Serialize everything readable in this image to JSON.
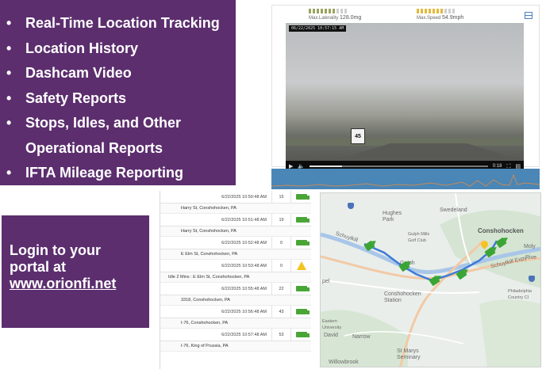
{
  "features": {
    "items": [
      "Real-Time Location Tracking",
      "Location History",
      "Dashcam Video",
      "Safety Reports",
      "Stops, Idles, and Other Operational Reports",
      "IFTA Mileage Reporting"
    ]
  },
  "login": {
    "line1": "Login to your",
    "line2": "portal at",
    "url": "www.orionfi.net"
  },
  "video": {
    "lateral_label": "Max.Laterality",
    "lateral_value": "128.0mg",
    "speed_label": "Max.Speed",
    "speed_value": "54.9mph",
    "timestamp": "06/22/2025 10:57:15 AM",
    "sign_text": "45",
    "time_readout": "0:18",
    "progress": 0.18,
    "colors": {
      "lateral": "#9aa35e",
      "speed": "#e2b93b"
    },
    "icons": [
      "play-icon",
      "volume-icon",
      "fullscreen-icon",
      "captions-icon",
      "layout-icon"
    ]
  },
  "stops": {
    "rows": [
      {
        "time": "6/22/2025 10:50:48 AM",
        "count": "15",
        "icon": "truck-icon",
        "location": "Harry St, Conshohocken, PA"
      },
      {
        "time": "6/22/2025 10:51:48 AM",
        "count": "19",
        "icon": "truck-icon",
        "location": "Harry St, Conshohocken, PA"
      },
      {
        "time": "6/22/2025 10:52:48 AM",
        "count": "0",
        "icon": "truck-icon",
        "location": "E Elm St, Conshohocken, PA"
      },
      {
        "time": "6/22/2025 10:53:48 AM",
        "count": "0",
        "icon": "warning-icon",
        "location": "Idle 2 Mins : E Elm St, Conshohocken, PA"
      },
      {
        "time": "6/22/2025 10:55:48 AM",
        "count": "22",
        "icon": "truck-icon",
        "location": "3318, Conshohocken, PA"
      },
      {
        "time": "6/22/2025 10:56:48 AM",
        "count": "43",
        "icon": "truck-icon",
        "location": "I-76, Conshohocken, PA"
      },
      {
        "time": "6/22/2025 10:57:48 AM",
        "count": "53",
        "icon": "truck-icon",
        "location": "I-76, King of Prussia, PA"
      }
    ]
  },
  "map": {
    "labels": {
      "swedeland": "Swedeland",
      "hughes_park": "Hughes\nPark",
      "gulph_mills": "Gulph Mills\nGolf Club",
      "conshohocken": "Conshohocken",
      "schuylkill": "Schuylkill",
      "schuylkill_expy": "Schuylkill Expy",
      "gulph": "Gulph",
      "conshohocken_station": "Conshohocken\nStation",
      "eastern": "Eastern\nUniversity",
      "david": "David",
      "narrow": "Narrow",
      "st_marys": "St Marys\nSeminary",
      "willowbrook": "Willowbrook",
      "philadelphia": "Philadelphia\nCountry Cl",
      "pel": "pel",
      "moly": "Moly",
      "rive": "Rive"
    },
    "colors": {
      "marker": "#3aa534",
      "route": "#3d7bd6",
      "river": "#a9c6e8"
    }
  }
}
